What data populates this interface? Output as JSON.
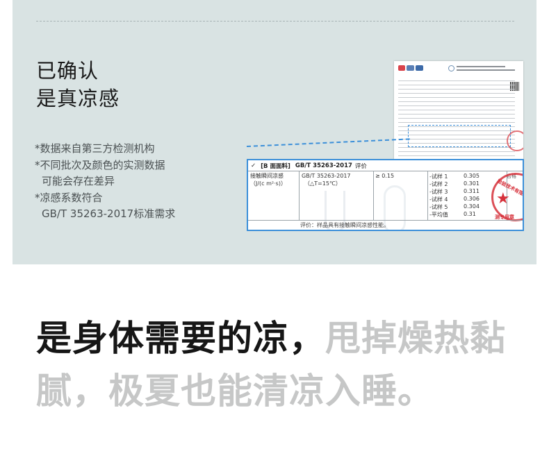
{
  "headline": {
    "line1": "已确认",
    "line2": "是真凉感"
  },
  "notes": {
    "line1": "*数据来自第三方检测机构",
    "line2": "*不同批次及颜色的实测数据",
    "line3": "可能会存在差异",
    "line4": "*凉感系数符合",
    "line5": "GB/T 35263-2017标准需求"
  },
  "zoom_table": {
    "check": "✓",
    "section": "[B 面面料]",
    "standard": "GB/T 35263-2017",
    "eval_header": "评价",
    "item_name": "接触瞬间凉感",
    "item_unit": "（J/(c m²·s)）",
    "method": "GB/T 35263-2017",
    "condition": "（△T=15℃）",
    "requirement": "≥ 0.15",
    "samples": [
      {
        "label": "-试样 1",
        "value": "0.305"
      },
      {
        "label": "-试样 2",
        "value": "0.301"
      },
      {
        "label": "-试样 3",
        "value": "0.311"
      },
      {
        "label": "-试样 4",
        "value": "0.306"
      },
      {
        "label": "-试样 5",
        "value": "0.304"
      },
      {
        "label": "-平均值",
        "value": "0.31"
      }
    ],
    "verdict": "合格",
    "footer": "评价：样品具有接触瞬间凉感性能。",
    "stamp_top": "检验技术有限公司",
    "stamp_bottom": "测专用章"
  },
  "slogan": {
    "part_dark": "是身体需要的凉，",
    "part_light": "甩掉燥热黏腻，极夏也能清凉入睡。"
  },
  "colors": {
    "panel_bg": "#d9e3e3",
    "highlight_blue": "#3b8fd9",
    "stamp_red": "#d6303a",
    "muted_text": "#c6c7c7"
  }
}
